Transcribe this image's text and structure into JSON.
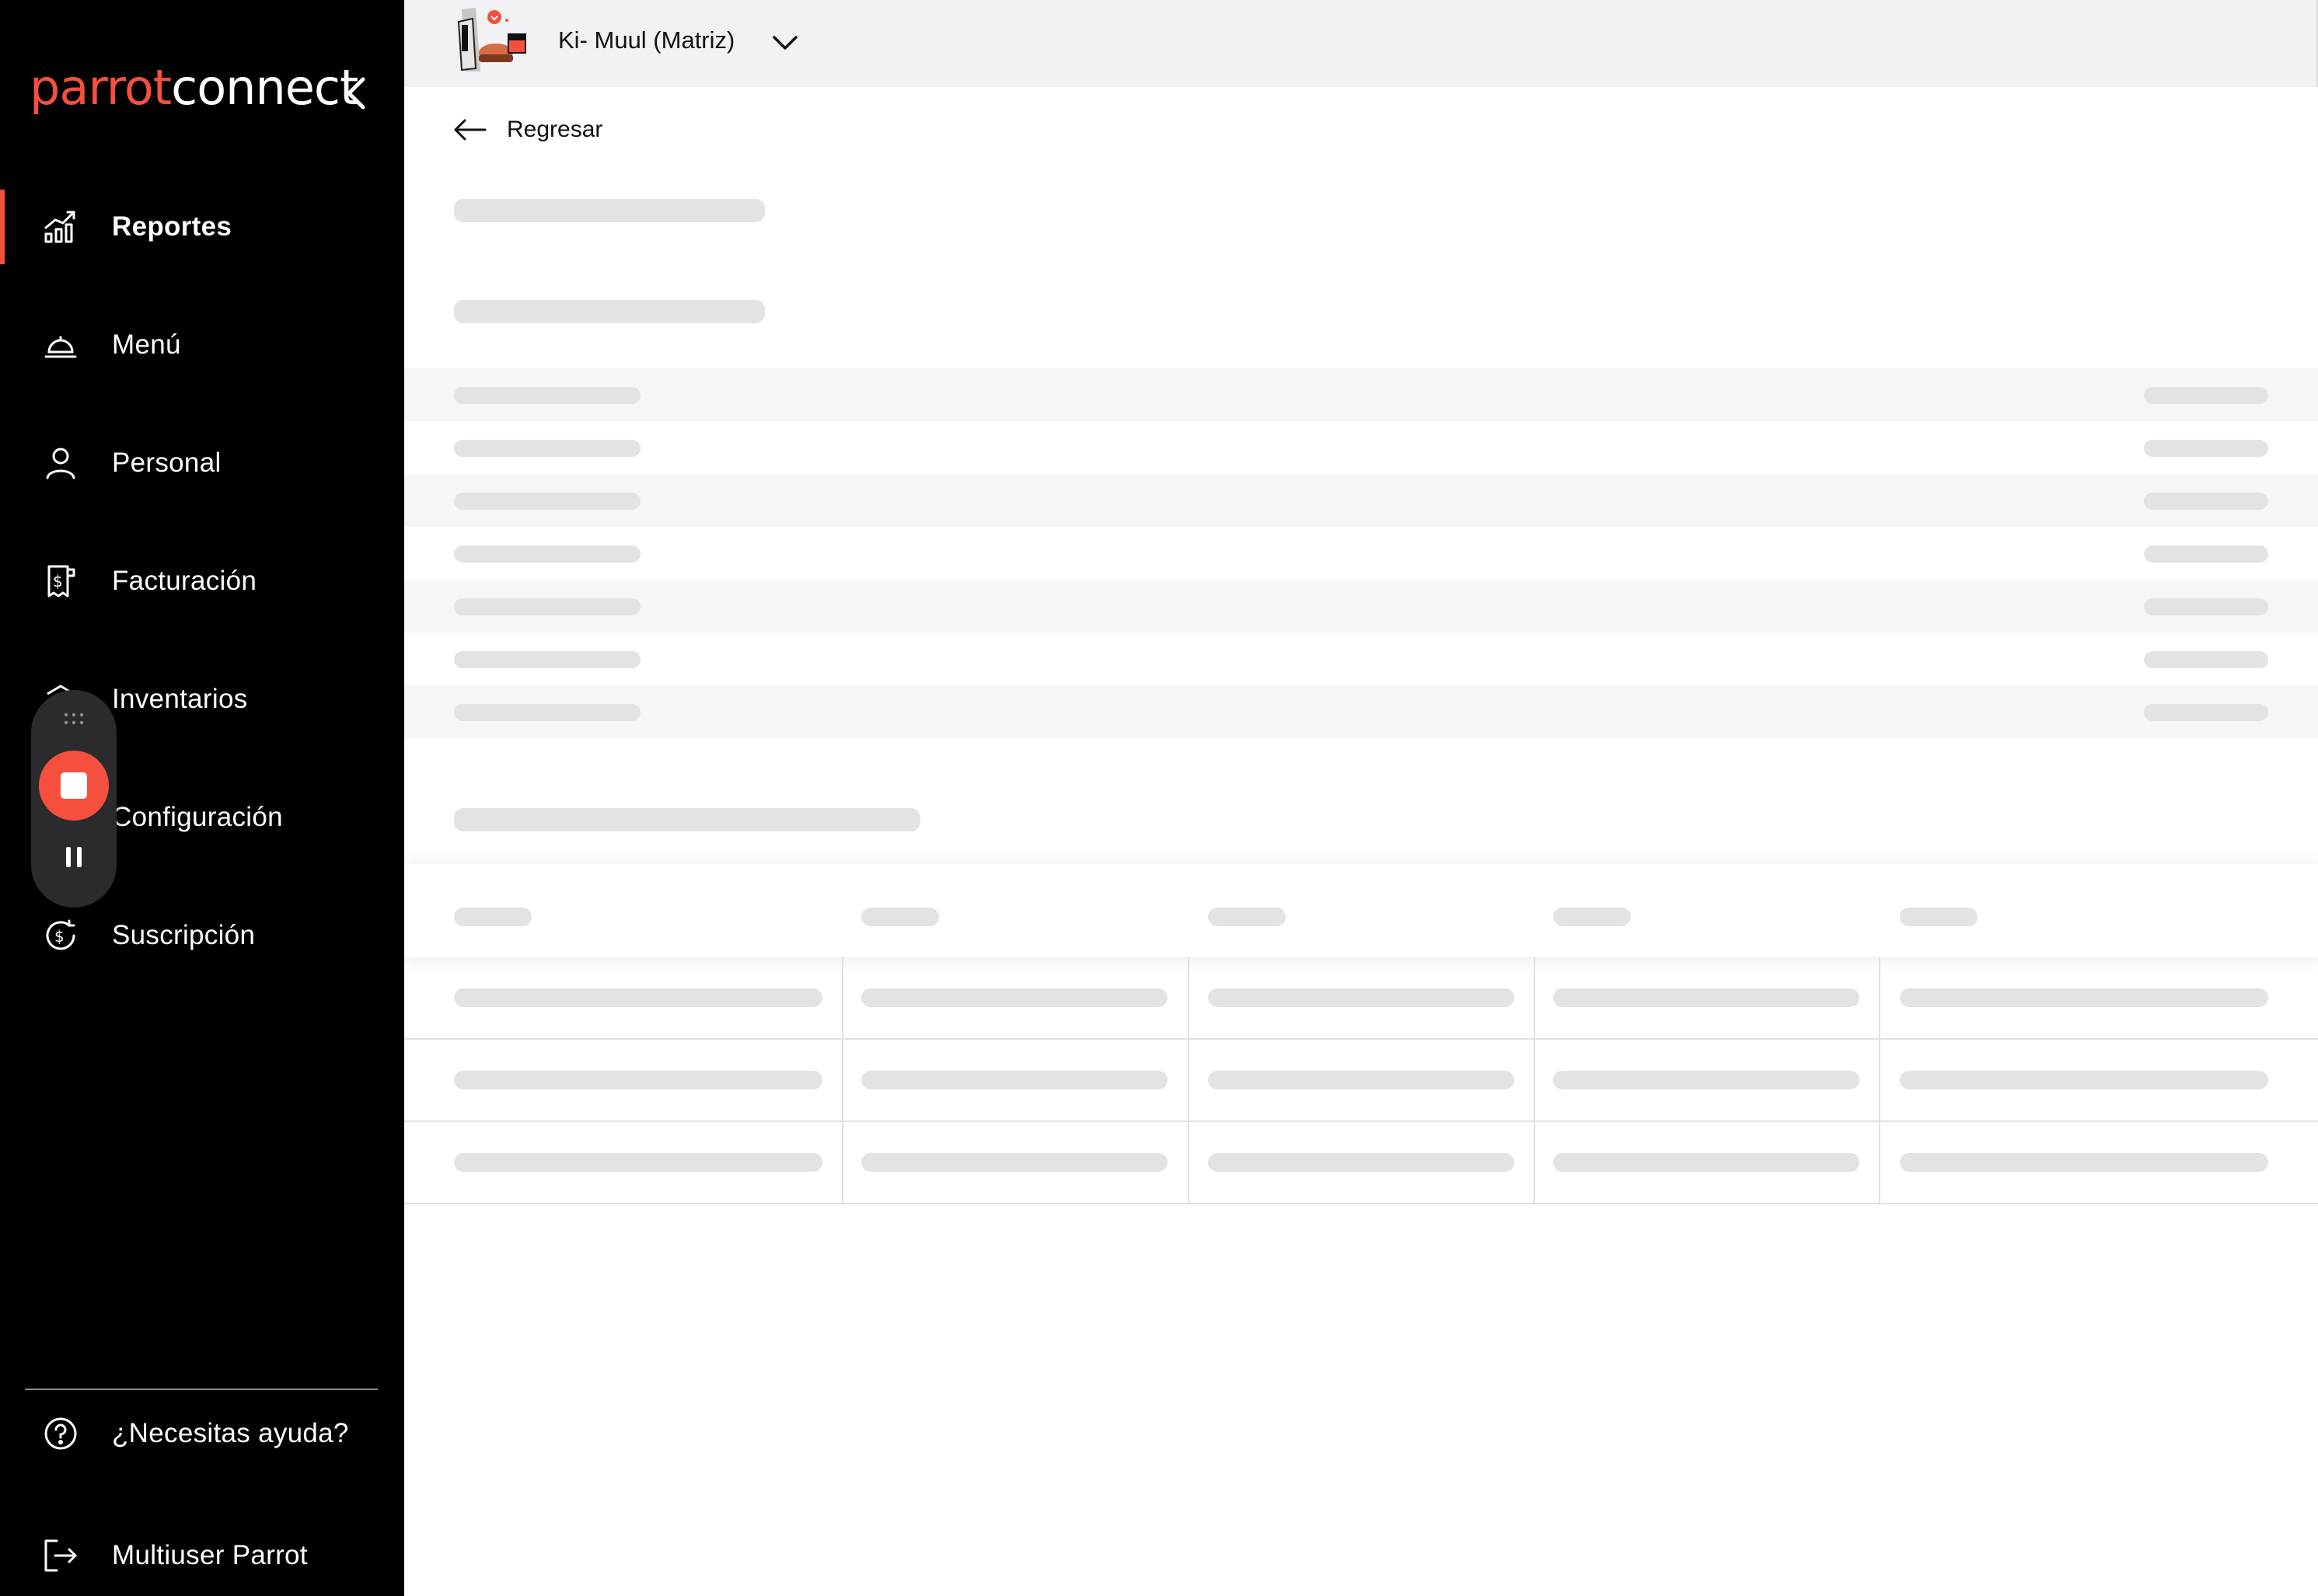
{
  "sidebar": {
    "logo_part1": "parrot",
    "logo_part2": "connect",
    "items": [
      {
        "label": "Reportes",
        "icon": "chart-icon"
      },
      {
        "label": "Menú",
        "icon": "cloche-icon"
      },
      {
        "label": "Personal",
        "icon": "person-icon"
      },
      {
        "label": "Facturación",
        "icon": "invoice-icon"
      },
      {
        "label": "Inventarios",
        "icon": "inventory-icon"
      },
      {
        "label": "Configuración",
        "icon": "settings-icon"
      },
      {
        "label": "Suscripción",
        "icon": "subscription-icon"
      }
    ],
    "help_label": "¿Necesitas ayuda?",
    "user_label": "Multiuser Parrot"
  },
  "topbar": {
    "branch_name": "Ki- Muul (Matriz)"
  },
  "main": {
    "back_label": "Regresar"
  },
  "colors": {
    "accent": "#f5503e",
    "sidebar_bg": "#000000",
    "topbar_bg": "#f2f2f4",
    "skeleton": "#e3e3e5"
  }
}
